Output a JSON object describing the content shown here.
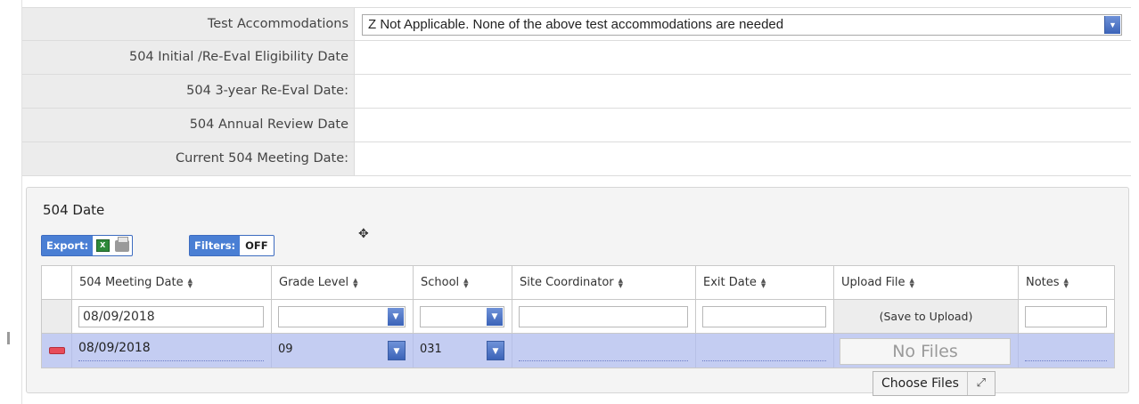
{
  "form": {
    "rows": [
      {
        "label": "Test Accommodations",
        "value": "Z Not Applicable. None of the above test accommodations are needed"
      },
      {
        "label": "504 Initial /Re-Eval Eligibility Date",
        "value": ""
      },
      {
        "label": "504 3-year Re-Eval Date:",
        "value": ""
      },
      {
        "label": "504 Annual Review Date",
        "value": ""
      },
      {
        "label": "Current 504 Meeting Date:",
        "value": ""
      }
    ],
    "arrow": "▼"
  },
  "panel": {
    "title": "504 Date",
    "export_label": "Export:",
    "export_icons": [
      "excel-icon",
      "print-icon"
    ],
    "filters_label": "Filters:",
    "filters_value": "OFF"
  },
  "grid": {
    "columns": [
      "504 Meeting Date",
      "Grade Level",
      "School",
      "Site Coordinator",
      "Exit Date",
      "Upload File",
      "Notes"
    ],
    "sort_glyph": "▲▼",
    "filter_row": {
      "meeting_date": "08/09/2018",
      "grade_level": "",
      "school": "",
      "site_coordinator": "",
      "exit_date": "",
      "upload_file": "(Save to Upload)",
      "notes": ""
    },
    "data_rows": [
      {
        "meeting_date": "08/09/2018",
        "grade_level": "09",
        "school": "031",
        "site_coordinator": "",
        "exit_date": "",
        "upload_file": "No Files",
        "notes": ""
      }
    ],
    "choose_files_label": "Choose Files"
  },
  "colors": {
    "selected_row": "#c4cdf2",
    "accent_blue": "#4a7fd4",
    "delete_red": "#e84c5a"
  }
}
